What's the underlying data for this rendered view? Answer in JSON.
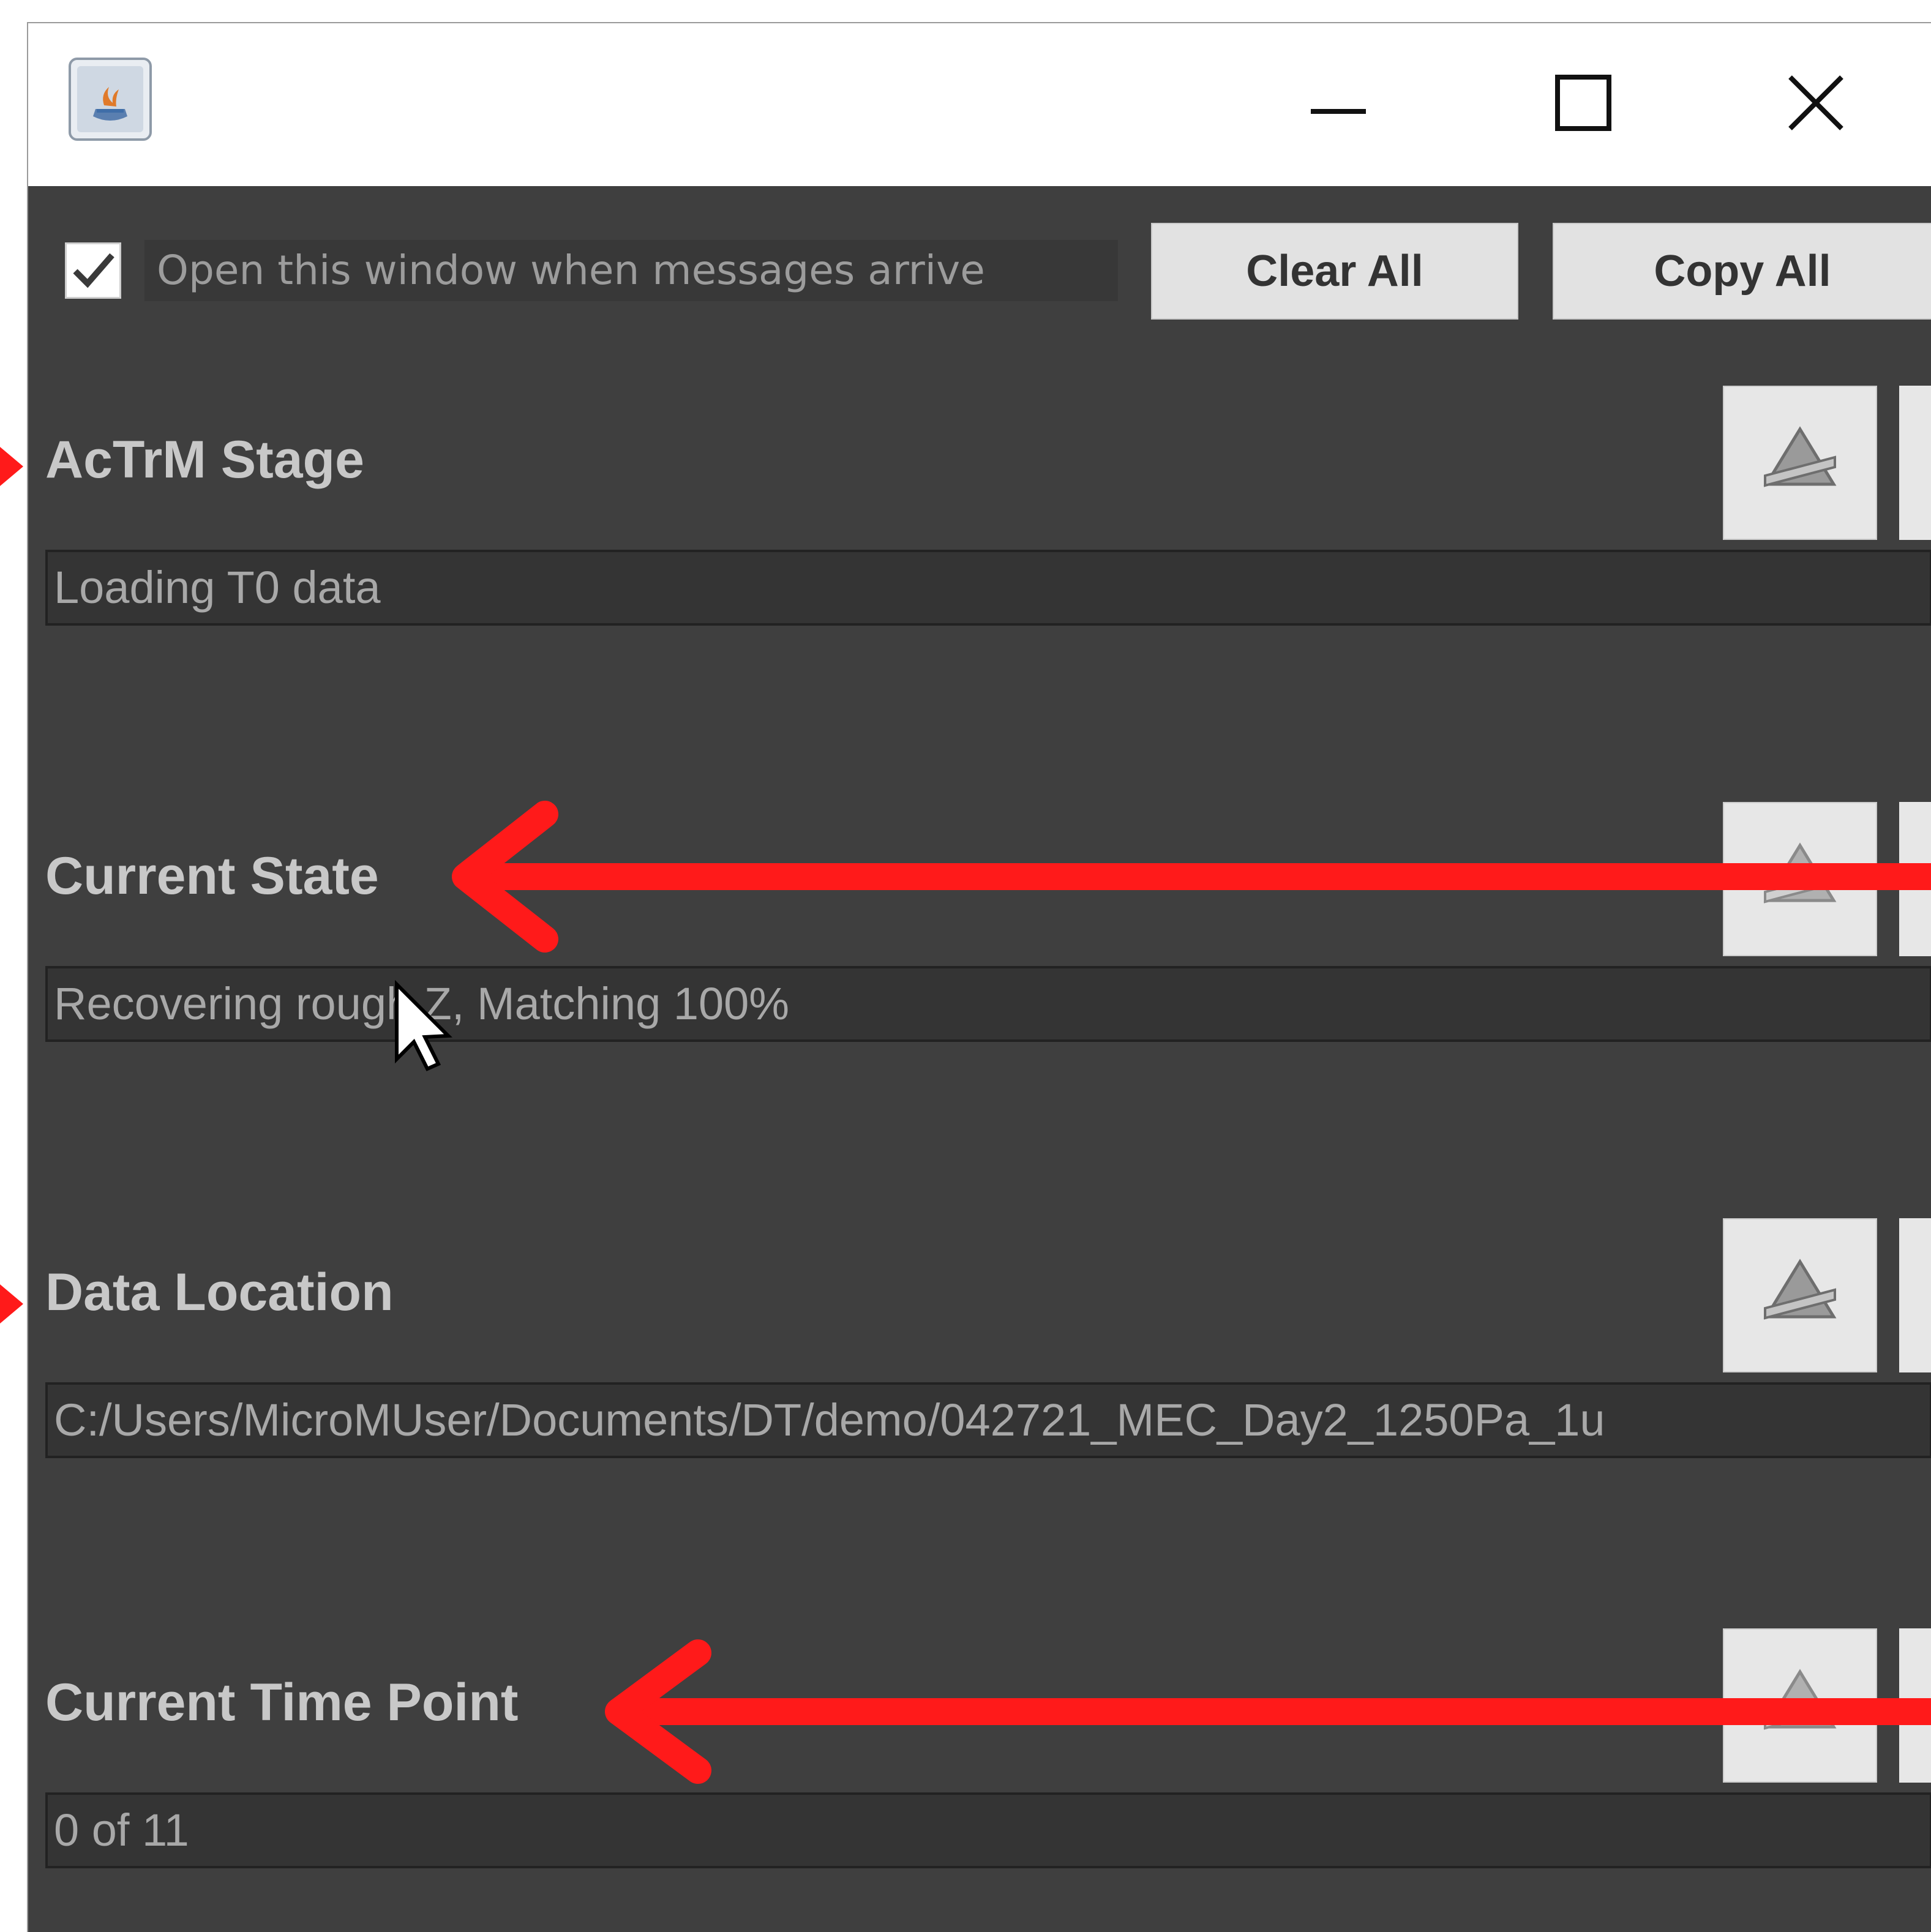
{
  "window": {
    "checkbox_label": "Open this window when messages arrive",
    "checkbox_checked": true,
    "clear_all_label": "Clear All",
    "copy_all_label": "Copy All"
  },
  "sections": [
    {
      "label": "AcTrM Stage",
      "value": "Loading T0 data"
    },
    {
      "label": "Current State",
      "value": "Recovering rough Z, Matching 100%"
    },
    {
      "label": "Data Location",
      "value": "C:/Users/MicroMUser/Documents/DT/demo/042721_MEC_Day2_1250Pa_1u"
    },
    {
      "label": "Current Time Point",
      "value": "0 of 11"
    }
  ],
  "icons": {
    "app": "java-app-icon",
    "minimize": "minimize-icon",
    "maximize": "maximize-icon",
    "close": "close-icon",
    "side_button": "eraser-icon",
    "annotation": "red-arrow"
  },
  "colors": {
    "window_bg": "#3f3f3f",
    "field_bg": "#343434",
    "label_text": "#c8c8c8",
    "annotation_red": "#ff1a1a"
  }
}
